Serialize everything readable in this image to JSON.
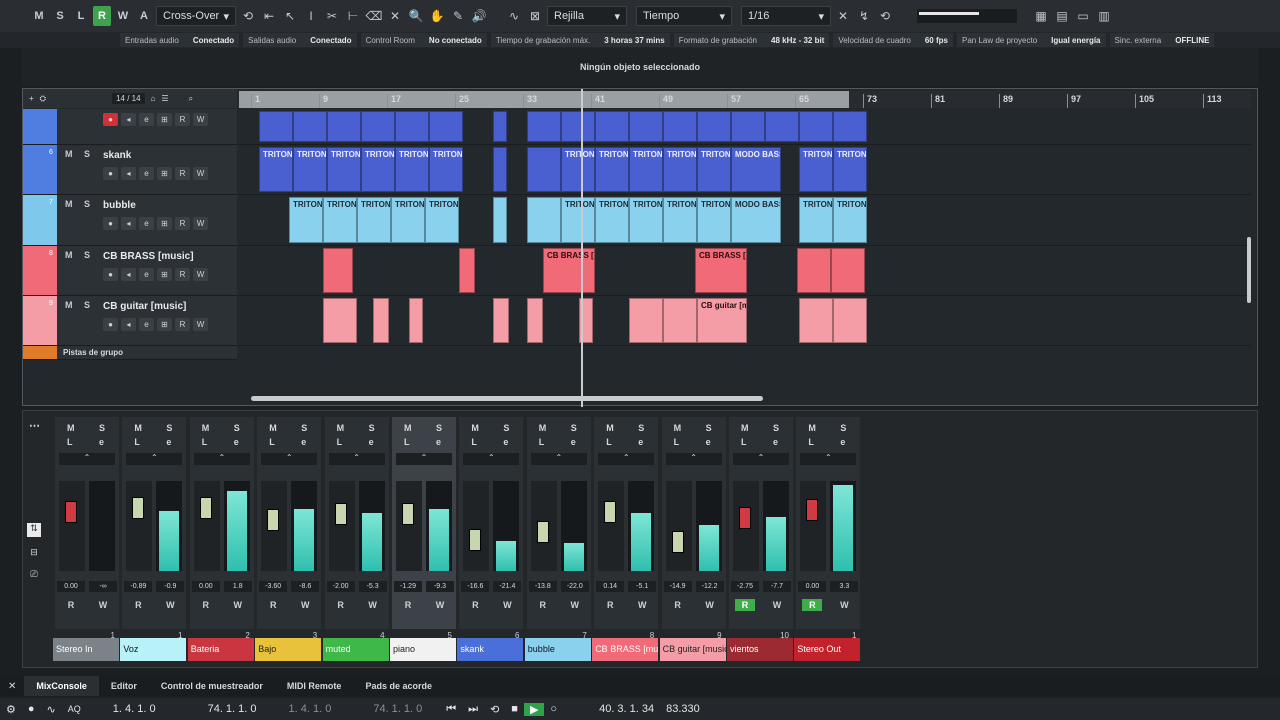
{
  "toolbar": {
    "buttons": [
      "M",
      "S",
      "L",
      "R",
      "W",
      "A"
    ],
    "crossover": "Cross-Over",
    "snap": "Rejilla",
    "time": "Tiempo",
    "quant": "1/16"
  },
  "status": [
    {
      "label": "Entradas audio",
      "value": "Conectado"
    },
    {
      "label": "Salidas audio",
      "value": "Conectado"
    },
    {
      "label": "Control Room",
      "value": "No conectado"
    },
    {
      "label": "Tiempo de grabación máx.",
      "value": "3 horas 37 mins"
    },
    {
      "label": "Formato de grabación",
      "value": "48 kHz - 32 bit"
    },
    {
      "label": "Velocidad de cuadro",
      "value": "60 fps"
    },
    {
      "label": "Pan Law de proyecto",
      "value": "Igual energía"
    },
    {
      "label": "Sinc. externa",
      "value": "OFFLINE"
    }
  ],
  "info": "Ningún objeto seleccionado",
  "project": {
    "count": "14 / 14",
    "ruler": [
      "1",
      "9",
      "17",
      "25",
      "33",
      "41",
      "49",
      "57",
      "65",
      "73",
      "81",
      "89",
      "97",
      "105",
      "113"
    ],
    "group_label": "Pistas de grupo",
    "tracks": [
      {
        "num": "",
        "name": "",
        "color": "#4f7ee0"
      },
      {
        "num": "6",
        "name": "skank",
        "color": "#4f7ee0"
      },
      {
        "num": "7",
        "name": "bubble",
        "color": "#7ec8ec"
      },
      {
        "num": "8",
        "name": "CB BRASS [music]",
        "color": "#f06a78"
      },
      {
        "num": "9",
        "name": "CB guitar [music]",
        "color": "#f59da6"
      }
    ],
    "clip_labels": {
      "triton": "TRITON",
      "modo": "MODO BASS",
      "brass": "CB BRASS [m",
      "guitar": "CB guitar [m"
    }
  },
  "mixer": {
    "channels": [
      {
        "name": "Stereo In",
        "num": "1",
        "vol": "0.00",
        "pan": "-∞",
        "color": "#7b8288",
        "text": "#fff"
      },
      {
        "name": "Voz",
        "num": "1",
        "vol": "-0.89",
        "pan": "-0.9",
        "color": "#b8f1f7",
        "text": "#112"
      },
      {
        "name": "Bateria",
        "num": "2",
        "vol": "0.00",
        "pan": "1.8",
        "color": "#c9363f",
        "text": "#fff"
      },
      {
        "name": "Bajo",
        "num": "3",
        "vol": "-3.60",
        "pan": "-8.6",
        "color": "#e8c23a",
        "text": "#222"
      },
      {
        "name": "muted",
        "num": "4",
        "vol": "-2.00",
        "pan": "-5.3",
        "color": "#3fb84a",
        "text": "#fff"
      },
      {
        "name": "piano",
        "num": "5",
        "vol": "-1.29",
        "pan": "-9.3",
        "color": "#f1f1f1",
        "text": "#222"
      },
      {
        "name": "skank",
        "num": "6",
        "vol": "-16.6",
        "pan": "-21.4",
        "color": "#4a6fd8",
        "text": "#fff"
      },
      {
        "name": "bubble",
        "num": "7",
        "vol": "-13.8",
        "pan": "-22.0",
        "color": "#8ad1ee",
        "text": "#112"
      },
      {
        "name": "CB BRASS [music]",
        "num": "8",
        "vol": "0.14",
        "pan": "-5.1",
        "color": "#f06a78",
        "text": "#fff"
      },
      {
        "name": "CB guitar [music]",
        "num": "9",
        "vol": "-14.9",
        "pan": "-12.2",
        "color": "#f59da6",
        "text": "#222"
      },
      {
        "name": "vientos",
        "num": "10",
        "vol": "-2.75",
        "pan": "-7.7",
        "color": "#9c2a33",
        "text": "#fff"
      },
      {
        "name": "Stereo Out",
        "num": "1",
        "vol": "0.00",
        "pan": "3.3",
        "color": "#c2222c",
        "text": "#fff"
      }
    ]
  },
  "tabs": [
    "MixConsole",
    "Editor",
    "Control de muestreador",
    "MIDI Remote",
    "Pads de acorde"
  ],
  "transport": {
    "left": "1. 4. 1. 0",
    "right": "74. 1. 1. 0",
    "pos1": "1. 4. 1. 0",
    "pos2": "74. 1. 1. 0",
    "time": "40. 3. 1. 34",
    "tempo": "83.330"
  }
}
